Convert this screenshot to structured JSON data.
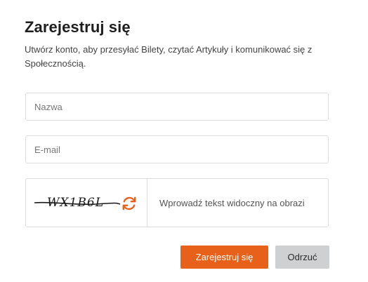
{
  "dialog": {
    "title": "Zarejestruj się",
    "subtitle": "Utwórz konto, aby przesyłać Bilety, czytać Artykuły i komunikować się z Społecznością."
  },
  "form": {
    "name_placeholder": "Nazwa",
    "email_placeholder": "E-mail",
    "captcha": {
      "image_text": "WX1B6L",
      "input_placeholder": "Wprowadź tekst widoczny na obrazi",
      "refresh_icon": "refresh-icon"
    }
  },
  "actions": {
    "submit_label": "Zarejestruj się",
    "cancel_label": "Odrzuć"
  },
  "colors": {
    "accent": "#e8611a",
    "secondary_button": "#cfd0d2",
    "border": "#dcdcdc"
  }
}
